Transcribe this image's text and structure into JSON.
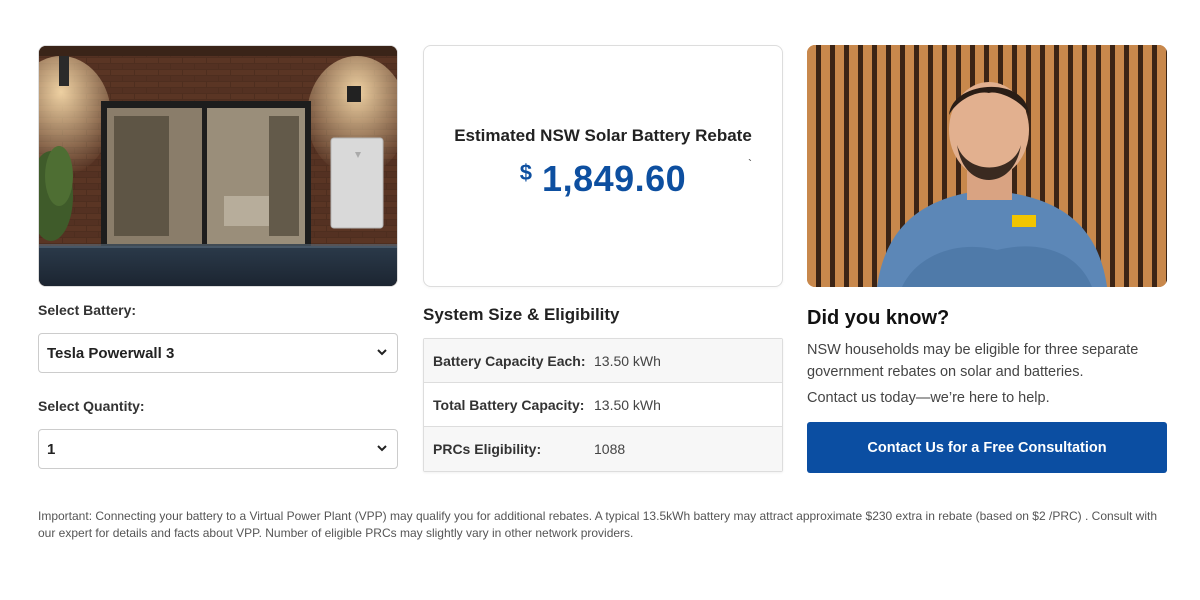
{
  "battery_form": {
    "battery_label": "Select Battery:",
    "battery_value": "Tesla Powerwall 3",
    "quantity_label": "Select Quantity:",
    "quantity_value": "1"
  },
  "rebate": {
    "title": "Estimated NSW Solar Battery Rebate",
    "currency": "$",
    "amount": "1,849.60",
    "stray_mark": "`"
  },
  "system": {
    "title": "System Size & Eligibility",
    "rows": [
      {
        "label": "Battery Capacity Each:",
        "value": "13.50 kWh"
      },
      {
        "label": "Total Battery Capacity:",
        "value": "13.50 kWh"
      },
      {
        "label": "PRCs Eligibility:",
        "value": "1088"
      }
    ]
  },
  "info": {
    "title": "Did you know?",
    "text": "NSW households may be eligible for three separate government rebates on solar and batteries.",
    "contact": "Contact us today—we’re here to help.",
    "cta_label": "Contact Us for a Free Consultation"
  },
  "footnote": "Important: Connecting your battery to a Virtual Power Plant (VPP) may qualify you for additional rebates. A typical 13.5kWh battery may attract approximate $230 extra in rebate (based on $2 /PRC) . Consult with our expert for details and facts about VPP. Number of eligible PRCs may slightly vary in other network providers.",
  "colors": {
    "accent_blue": "#0b4ea2",
    "amount_blue": "#0d4fa0"
  },
  "icons": {
    "select_arrow": "chevron-down-icon"
  }
}
